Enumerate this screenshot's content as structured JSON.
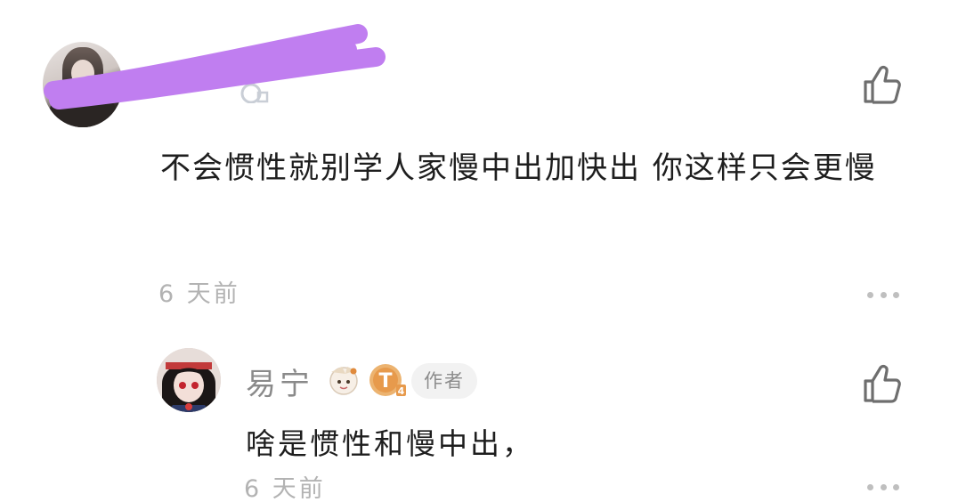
{
  "comment": {
    "text": "不会惯性就别学人家慢中出加快出 你这样只会更慢",
    "time": "6 天前",
    "like_icon": "thumbs-up-icon",
    "more_icon": "more-horizontal-icon"
  },
  "reply": {
    "username": "易宁",
    "author_tag": "作者",
    "text": "啥是惯性和慢中出，",
    "time": "6 天前",
    "level_badge_icon": "level-badge-icon",
    "sticker_icon": "sticker-badge-icon",
    "like_icon": "thumbs-up-icon",
    "more_icon": "more-horizontal-icon"
  },
  "colors": {
    "text": "#1e1e1e",
    "muted": "#b3b3b3",
    "username": "#8a8a8a",
    "redaction": "#c07ef0",
    "level_badge": "#e8a15a",
    "tag_bg": "#f2f2f2"
  }
}
